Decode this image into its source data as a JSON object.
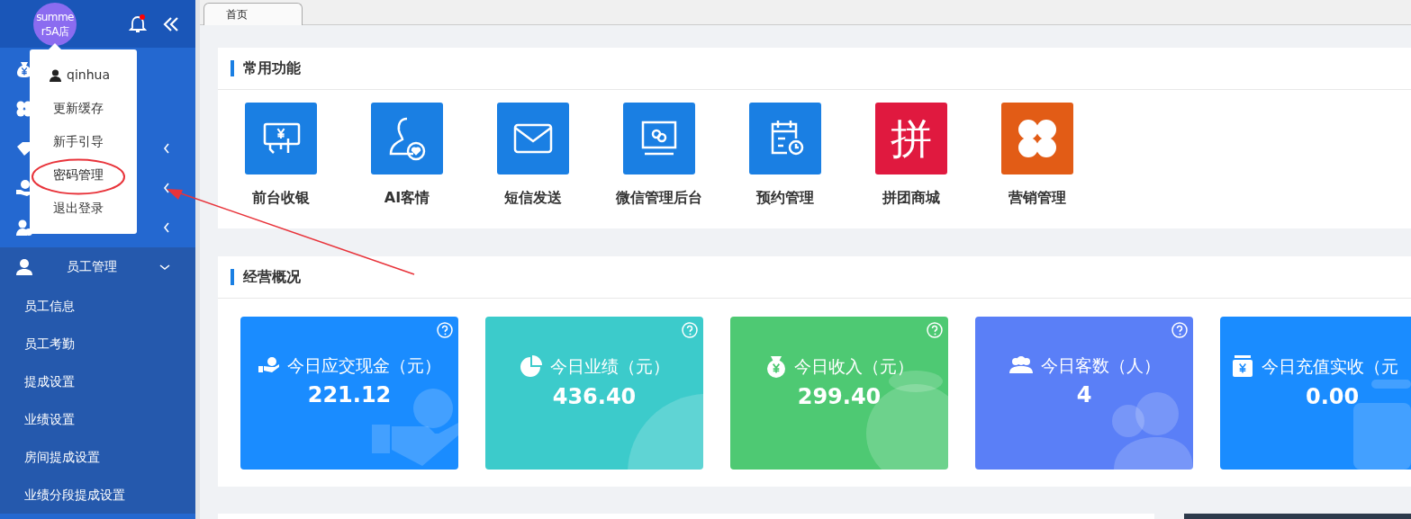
{
  "header": {
    "store_name": "summer5A店",
    "notification_unread": true
  },
  "user_menu": {
    "username": "qinhua",
    "items": [
      {
        "label": "更新缓存",
        "highlighted": false
      },
      {
        "label": "新手引导",
        "highlighted": false
      },
      {
        "label": "密码管理",
        "highlighted": true
      },
      {
        "label": "退出登录",
        "highlighted": false
      }
    ]
  },
  "sidebar": {
    "items": [
      {
        "kind": "link"
      },
      {
        "kind": "link"
      },
      {
        "kind": "group",
        "expanded": false
      },
      {
        "kind": "group",
        "expanded": false
      },
      {
        "kind": "group",
        "expanded": false
      },
      {
        "kind": "group",
        "label": "员工管理",
        "expanded": true,
        "children": [
          {
            "label": "员工信息"
          },
          {
            "label": "员工考勤"
          },
          {
            "label": "提成设置"
          },
          {
            "label": "业绩设置"
          },
          {
            "label": "房间提成设置"
          },
          {
            "label": "业绩分段提成设置"
          }
        ]
      }
    ]
  },
  "tabs": [
    {
      "label": "首页",
      "selected": true
    }
  ],
  "shortcuts": {
    "title": "常用功能",
    "items": [
      {
        "label": "前台收银",
        "color": "#1a7fe3"
      },
      {
        "label": "AI客情",
        "color": "#1a7fe3"
      },
      {
        "label": "短信发送",
        "color": "#1a7fe3"
      },
      {
        "label": "微信管理后台",
        "color": "#1a7fe3"
      },
      {
        "label": "预约管理",
        "color": "#1a7fe3"
      },
      {
        "label": "拼团商城",
        "color": "#e0193f",
        "glyph": "拼"
      },
      {
        "label": "营销管理",
        "color": "#e25c16"
      }
    ]
  },
  "overview": {
    "title": "经营概况",
    "cards": [
      {
        "title": "今日应交现金（元）",
        "value": "221.12",
        "color": "#1a8cff",
        "help": true
      },
      {
        "title": "今日业绩（元）",
        "value": "436.40",
        "color": "#3ccbcb",
        "help": true
      },
      {
        "title": "今日收入（元）",
        "value": "299.40",
        "color": "#4ec973",
        "help": true
      },
      {
        "title": "今日客数（人）",
        "value": "4",
        "color": "#5a7ff7",
        "help": true
      },
      {
        "title": "今日充值实收（元",
        "value": "0.00",
        "color": "#1a8cff",
        "help": false
      }
    ]
  }
}
